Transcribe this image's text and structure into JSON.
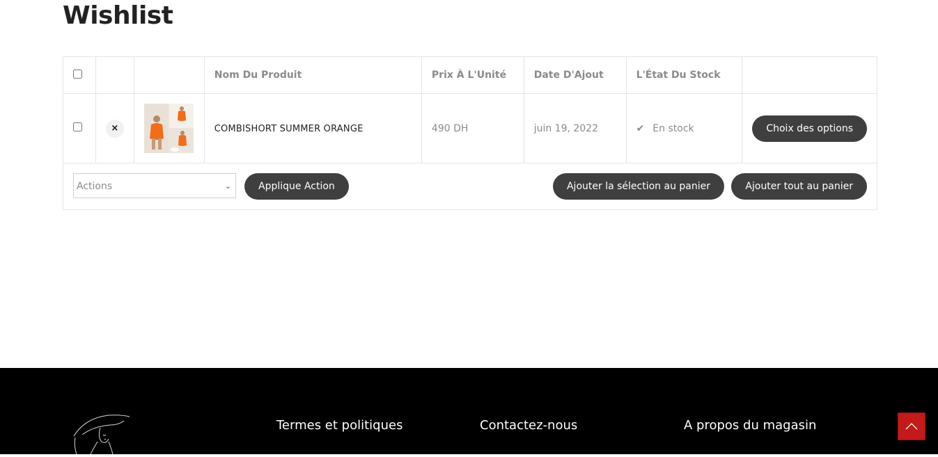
{
  "page": {
    "title": "Wishlist"
  },
  "table": {
    "headers": {
      "name": "Nom Du Produit",
      "price": "Prix À L'Unité",
      "date": "Date D'Ajout",
      "stock": "L'État Du Stock"
    },
    "rows": [
      {
        "name": "COMBISHORT SUMMER ORANGE",
        "price": "490 DH",
        "date": "juin 19, 2022",
        "stock": "En stock",
        "action_label": "Choix des options",
        "remove_symbol": "×"
      }
    ],
    "footer": {
      "actions_select_value": "Actions",
      "apply_label": "Applique Action",
      "add_selection_label": "Ajouter la sélection au panier",
      "add_all_label": "Ajouter tout au panier"
    }
  },
  "footer": {
    "headings": [
      "Termes et politiques",
      "Contactez-nous",
      "A propos du magasin"
    ]
  },
  "icons": {
    "stock": "check-icon",
    "remove": "close-icon",
    "select": "chevron-down-icon",
    "scroll_top": "chevron-up-icon"
  },
  "colors": {
    "button_bg": "#3f3f3f",
    "footer_bg": "#000000",
    "scroll_top_bg": "#c41a1a",
    "product_orange": "#f26c1a"
  }
}
